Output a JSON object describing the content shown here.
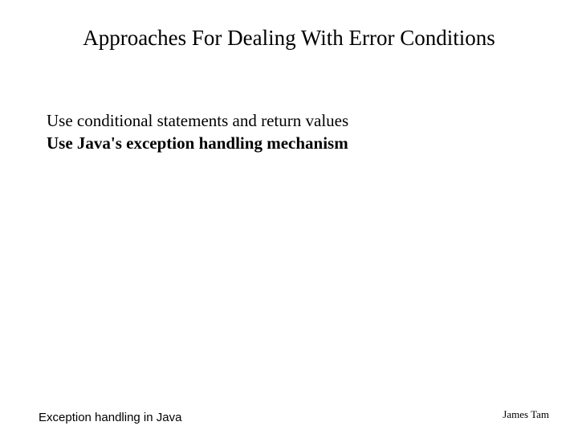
{
  "slide": {
    "title": "Approaches For Dealing With Error Conditions",
    "bullets": [
      "Use conditional statements and return values",
      "Use Java's exception handling mechanism"
    ],
    "footer": {
      "left": "Exception handling in Java",
      "right": "James Tam"
    }
  }
}
